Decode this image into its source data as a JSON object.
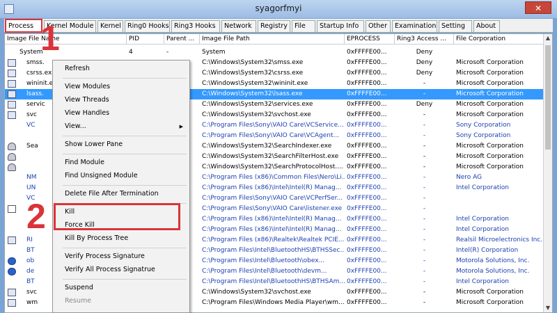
{
  "window": {
    "title": "syagorfmyi",
    "close_label": "✕"
  },
  "tabs": [
    {
      "label": "Process",
      "active": true
    },
    {
      "label": "Kernel Module"
    },
    {
      "label": "Kernel"
    },
    {
      "label": "Ring0 Hooks"
    },
    {
      "label": "Ring3 Hooks"
    },
    {
      "label": "Network"
    },
    {
      "label": "Registry"
    },
    {
      "label": "File"
    },
    {
      "label": "Startup Info"
    },
    {
      "label": "Other"
    },
    {
      "label": "Examination"
    },
    {
      "label": "Setting"
    },
    {
      "label": "About"
    }
  ],
  "columns": [
    "Image File Name",
    "PID",
    "Parent ...",
    "Image File Path",
    "EPROCESS",
    "Ring3 Access ...",
    "File Corporation"
  ],
  "rows": [
    {
      "icon": "none",
      "name": "System",
      "pid": "4",
      "parent": "-",
      "path": "System",
      "eprocess": "0xFFFFE00...",
      "ring3": "Deny",
      "corp": ""
    },
    {
      "icon": "app",
      "name": "smss.",
      "pid": "",
      "parent": "",
      "path": "C:\\Windows\\System32\\smss.exe",
      "eprocess": "0xFFFFE00...",
      "ring3": "Deny",
      "corp": "Microsoft Corporation"
    },
    {
      "icon": "app",
      "name": "csrss.ex",
      "pid": "",
      "parent": "",
      "path": "C:\\Windows\\System32\\csrss.exe",
      "eprocess": "0xFFFFE00...",
      "ring3": "Deny",
      "corp": "Microsoft Corporation"
    },
    {
      "icon": "app",
      "name": "wininit.e",
      "pid": "",
      "parent": "",
      "path": "C:\\Windows\\System32\\wininit.exe",
      "eprocess": "0xFFFFE00...",
      "ring3": "-",
      "corp": "Microsoft Corporation"
    },
    {
      "icon": "app",
      "name": "lsass.",
      "pid": "",
      "parent": "",
      "path": "C:\\Windows\\System32\\lsass.exe",
      "eprocess": "0xFFFFE00...",
      "ring3": "-",
      "corp": "Microsoft Corporation",
      "selected": true
    },
    {
      "icon": "app",
      "name": "servic",
      "pid": "",
      "parent": "",
      "path": "C:\\Windows\\System32\\services.exe",
      "eprocess": "0xFFFFE00...",
      "ring3": "Deny",
      "corp": "Microsoft Corporation"
    },
    {
      "icon": "app",
      "name": "svc",
      "pid": "",
      "parent": "",
      "path": "C:\\Windows\\System32\\svchost.exe",
      "eprocess": "0xFFFFE00...",
      "ring3": "-",
      "corp": "Microsoft Corporation"
    },
    {
      "icon": "none",
      "name": "VC",
      "pid": "",
      "parent": "",
      "path": "C:\\Program Files\\Sony\\VAIO Care\\VCService...",
      "eprocess": "0xFFFFE00...",
      "ring3": "-",
      "corp": "Sony Corporation",
      "blue": true
    },
    {
      "icon": "none",
      "name": "",
      "pid": "",
      "parent": "",
      "path": "C:\\Program Files\\Sony\\VAIO Care\\VCAgent...",
      "eprocess": "0xFFFFE00...",
      "ring3": "-",
      "corp": "Sony Corporation",
      "blue": true
    },
    {
      "icon": "user",
      "name": "Sea",
      "pid": "",
      "parent": "",
      "path": "C:\\Windows\\System32\\SearchIndexer.exe",
      "eprocess": "0xFFFFE00...",
      "ring3": "-",
      "corp": "Microsoft Corporation"
    },
    {
      "icon": "user",
      "name": "",
      "pid": "",
      "parent": "",
      "path": "C:\\Windows\\System32\\SearchFilterHost.exe",
      "eprocess": "0xFFFFE00...",
      "ring3": "-",
      "corp": "Microsoft Corporation"
    },
    {
      "icon": "user",
      "name": "",
      "pid": "",
      "parent": "",
      "path": "C:\\Windows\\System32\\SearchProtocolHost....",
      "eprocess": "0xFFFFE00...",
      "ring3": "-",
      "corp": "Microsoft Corporation"
    },
    {
      "icon": "none",
      "name": "NM",
      "pid": "",
      "parent": "",
      "path": "C:\\Program Files (x86)\\Common Files\\Nero\\Li...",
      "eprocess": "0xFFFFE00...",
      "ring3": "-",
      "corp": "Nero AG",
      "blue": true
    },
    {
      "icon": "none",
      "name": "UN",
      "pid": "",
      "parent": "",
      "path": "C:\\Program Files (x86)\\Intel\\Intel(R) Manag...",
      "eprocess": "0xFFFFE00...",
      "ring3": "-",
      "corp": "Intel Corporation",
      "blue": true
    },
    {
      "icon": "none",
      "name": "VC",
      "pid": "",
      "parent": "",
      "path": "C:\\Program Files\\Sony\\VAIO Care\\VCPerfSer...",
      "eprocess": "0xFFFFE00...",
      "ring3": "-",
      "corp": "",
      "blue": true
    },
    {
      "icon": "win",
      "name": "",
      "pid": "",
      "parent": "",
      "path": "C:\\Program Files\\Sony\\VAIO Care\\listener.exe",
      "eprocess": "0xFFFFE00...",
      "ring3": "-",
      "corp": "",
      "blue": true
    },
    {
      "icon": "none",
      "name": "",
      "pid": "",
      "parent": "",
      "path": "C:\\Program Files (x86)\\Intel\\Intel(R) Manag...",
      "eprocess": "0xFFFFE00...",
      "ring3": "-",
      "corp": "Intel Corporation",
      "blue": true
    },
    {
      "icon": "none",
      "name": "",
      "pid": "",
      "parent": "",
      "path": "C:\\Program Files (x86)\\Intel\\Intel(R) Manag...",
      "eprocess": "0xFFFFE00...",
      "ring3": "-",
      "corp": "Intel Corporation",
      "blue": true
    },
    {
      "icon": "app",
      "name": "RI",
      "pid": "",
      "parent": "",
      "path": "C:\\Program Files (x86)\\Realtek\\Realtek PCIE...",
      "eprocess": "0xFFFFE00...",
      "ring3": "-",
      "corp": "Realsil Microelectronics Inc.",
      "blue": true
    },
    {
      "icon": "none",
      "name": "BT",
      "pid": "",
      "parent": "",
      "path": "C:\\Program Files\\Intel\\BluetoothHS\\BTHSSec...",
      "eprocess": "0xFFFFE00...",
      "ring3": "-",
      "corp": "Intel(R) Corporation",
      "blue": true
    },
    {
      "icon": "bt",
      "name": "ob",
      "pid": "",
      "parent": "",
      "path": "C:\\Program Files\\Intel\\Bluetooth\\obex...",
      "eprocess": "0xFFFFE00...",
      "ring3": "-",
      "corp": "Motorola Solutions, Inc.",
      "blue": true
    },
    {
      "icon": "bt",
      "name": "de",
      "pid": "",
      "parent": "",
      "path": "C:\\Program Files\\Intel\\Bluetooth\\devm...",
      "eprocess": "0xFFFFE00...",
      "ring3": "-",
      "corp": "Motorola Solutions, Inc.",
      "blue": true
    },
    {
      "icon": "none",
      "name": "BT",
      "pid": "",
      "parent": "",
      "path": "C:\\Program Files\\Intel\\BluetoothHS\\BTHSAm...",
      "eprocess": "0xFFFFE00...",
      "ring3": "-",
      "corp": "Intel Corporation",
      "blue": true
    },
    {
      "icon": "app",
      "name": "svc",
      "pid": "",
      "parent": "",
      "path": "C:\\Windows\\System32\\svchost.exe",
      "eprocess": "0xFFFFE00...",
      "ring3": "-",
      "corp": "Microsoft Corporation"
    },
    {
      "icon": "app",
      "name": "wm",
      "pid": "",
      "parent": "",
      "path": "C:\\Program Files\\Windows Media Player\\wm...",
      "eprocess": "0xFFFFE00...",
      "ring3": "-",
      "corp": "Microsoft Corporation"
    }
  ],
  "context_menu": {
    "items": [
      {
        "label": "Refresh"
      },
      {
        "sep": true
      },
      {
        "label": "View Modules"
      },
      {
        "label": "View Threads"
      },
      {
        "label": "View Handles"
      },
      {
        "label": "View...",
        "submenu": true
      },
      {
        "sep": true
      },
      {
        "label": "Show Lower Pane"
      },
      {
        "sep": true
      },
      {
        "label": "Find Module"
      },
      {
        "label": "Find Unsigned Module"
      },
      {
        "sep": true
      },
      {
        "label": "Delete File After Termination"
      },
      {
        "sep": true
      },
      {
        "label": "Kill"
      },
      {
        "label": "Force Kill"
      },
      {
        "label": "Kill By Process Tree"
      },
      {
        "sep": true
      },
      {
        "label": "Verify Process Signature"
      },
      {
        "label": "Verify All Process Signatrue"
      },
      {
        "sep": true
      },
      {
        "label": "Suspend"
      },
      {
        "label": "Resume",
        "disabled": true
      }
    ]
  },
  "annotations": {
    "step1": "1",
    "step2": "2"
  },
  "colors": {
    "highlight": "#d9343a",
    "selection": "#3399ff",
    "signed_text": "#000000",
    "unsigned_text": "#1a3fb0"
  }
}
